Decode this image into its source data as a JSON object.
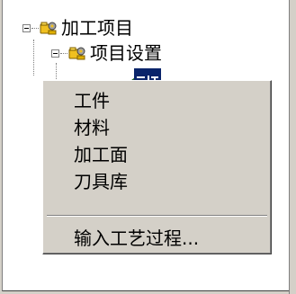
{
  "tree": {
    "root": {
      "label": "加工项目",
      "expanded": true,
      "icon": "folder-gear-icon"
    },
    "child": {
      "label": "项目设置",
      "expanded": true,
      "icon": "folder-gear-icon"
    }
  },
  "context_menu": {
    "items": [
      {
        "label": "工件"
      },
      {
        "label": "材料"
      },
      {
        "label": "加工面"
      },
      {
        "label": "刀具库"
      }
    ],
    "footer_item": {
      "label": "输入工艺过程..."
    }
  },
  "colors": {
    "menu_bg": "#d4d0c8",
    "selection": "#0a246a",
    "icon_yellow": "#f0c020"
  }
}
